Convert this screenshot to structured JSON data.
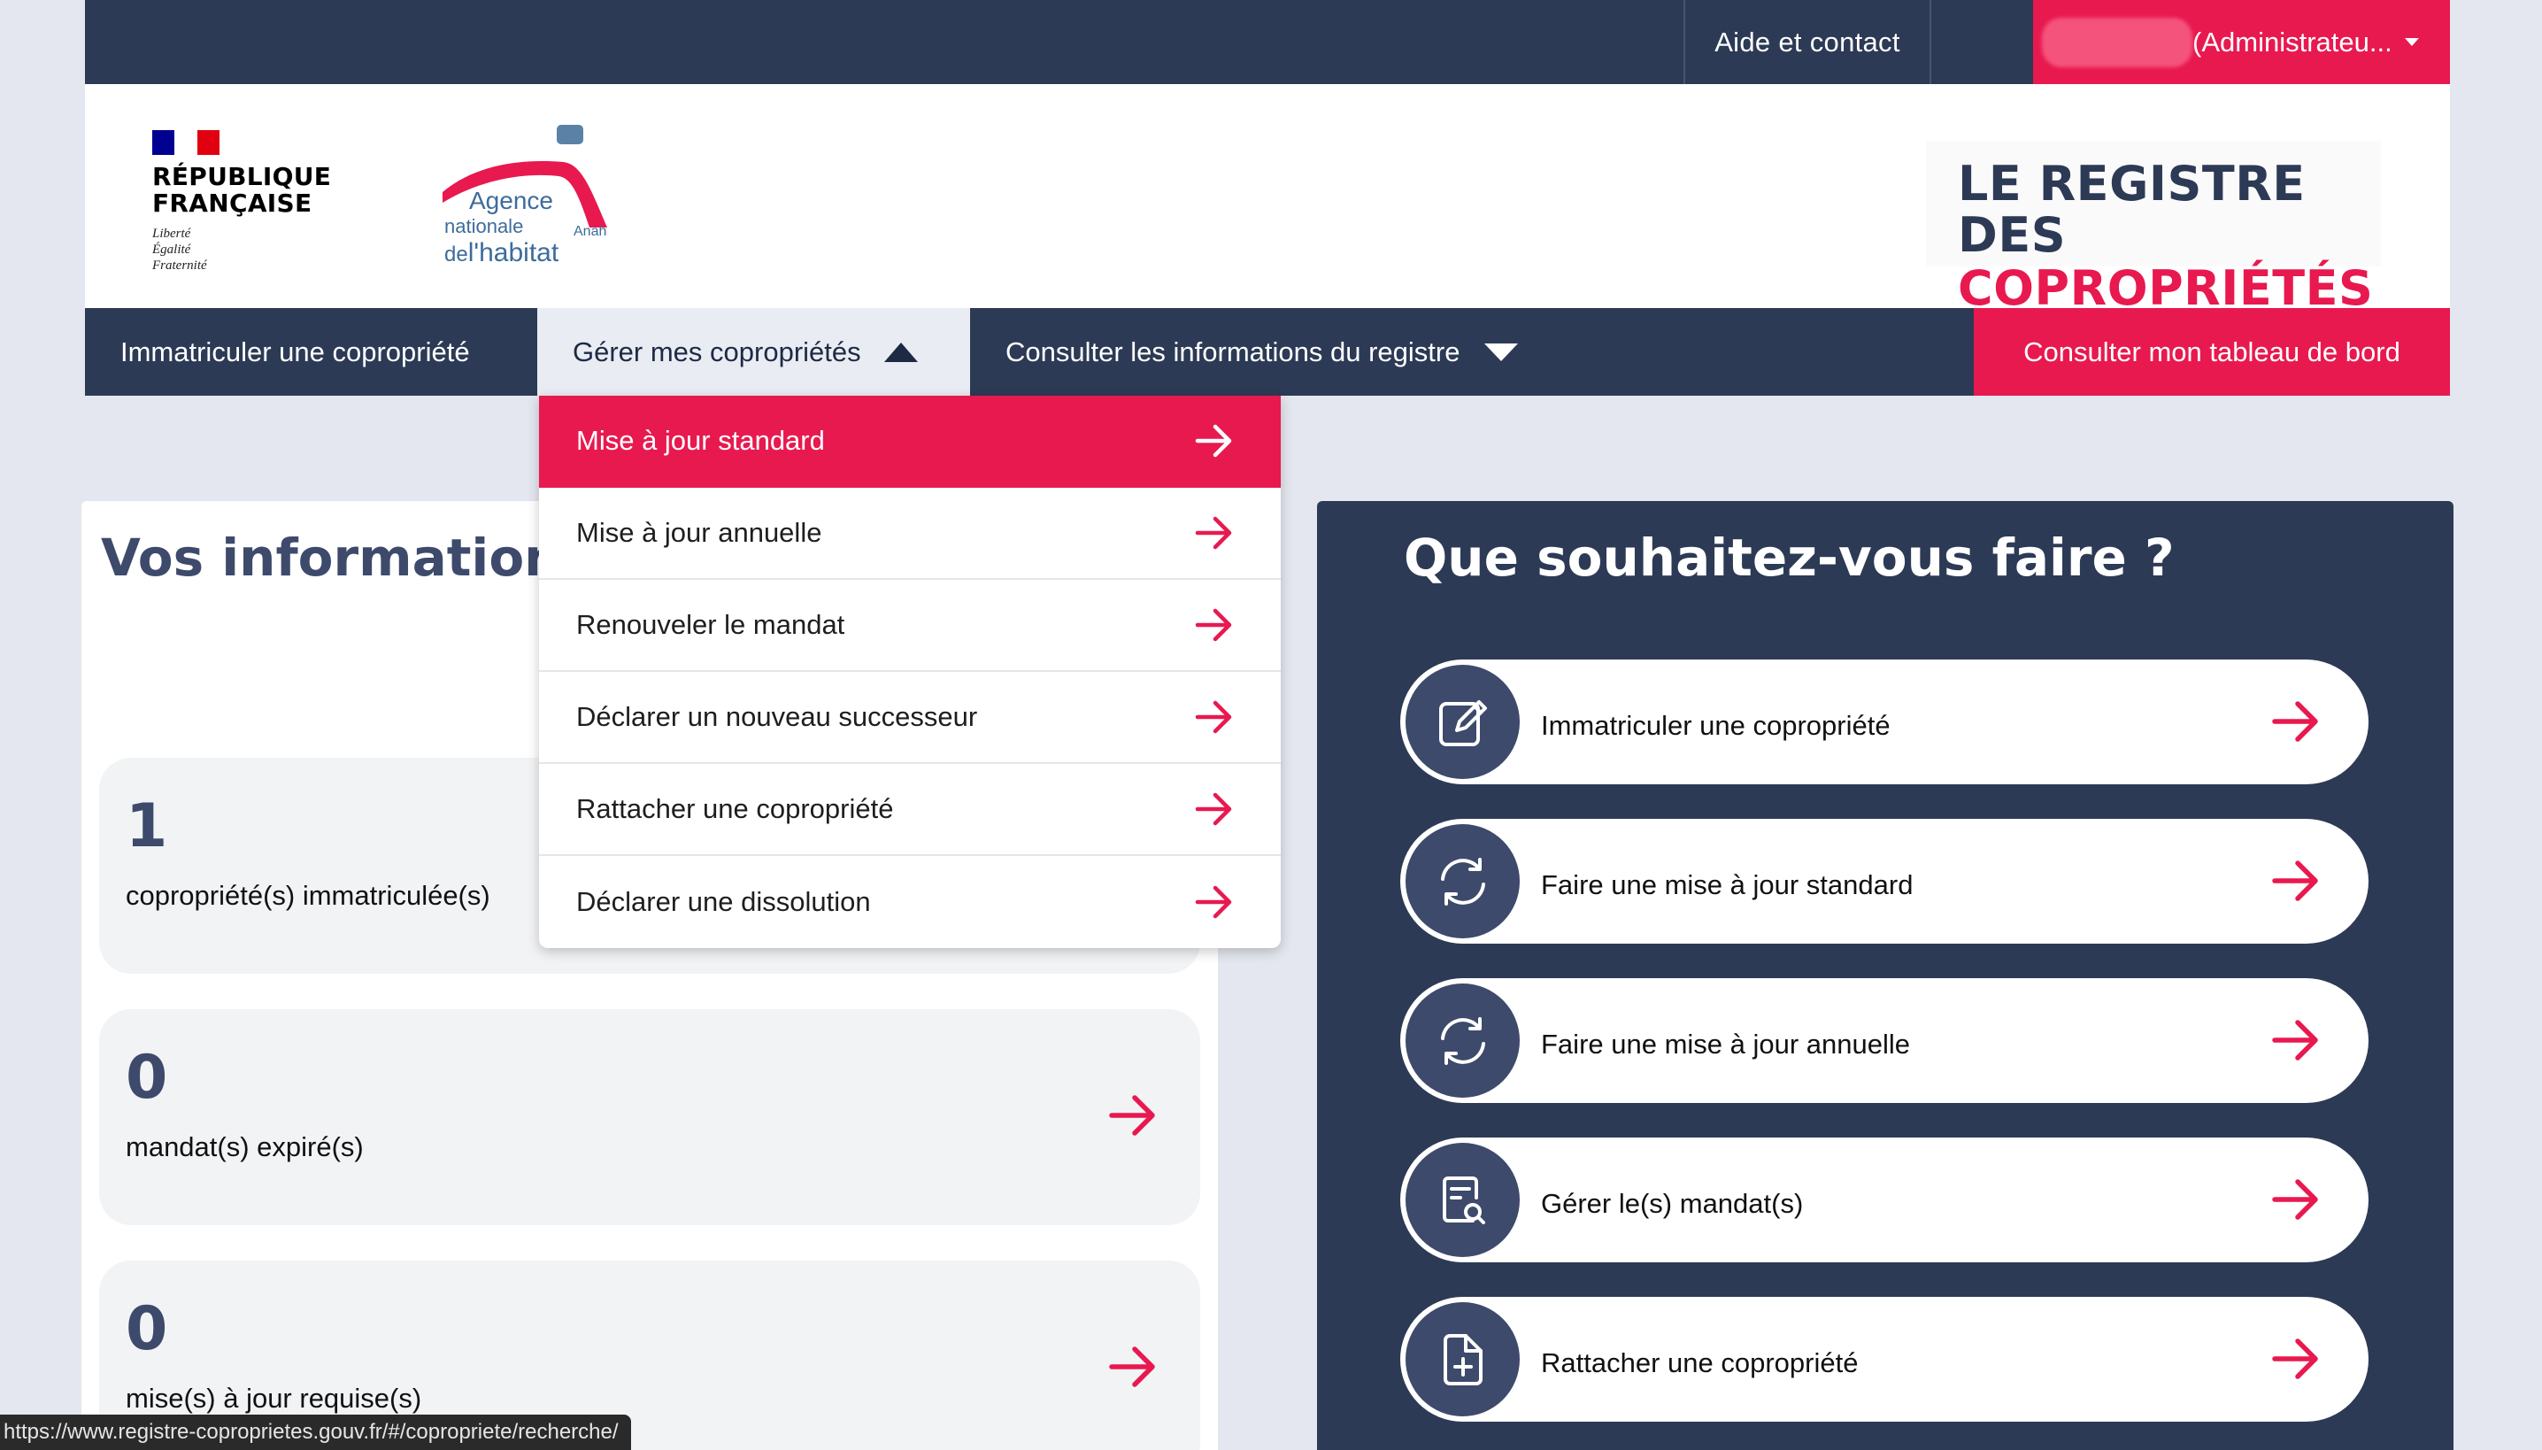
{
  "topbar": {
    "help_label": "Aide et contact",
    "bell_icon": "bell-icon",
    "user_role": "(Administrateu...",
    "user_caret_icon": "caret-down-icon"
  },
  "header": {
    "republique": [
      "RÉPUBLIQUE",
      "FRANÇAISE"
    ],
    "motto": [
      "Liberté",
      "Égalité",
      "Fraternité"
    ],
    "anah": {
      "line1": "Agence",
      "line2": "nationale",
      "line3_prefix": "de",
      "line3": "l'habitat",
      "tag": "Anah"
    },
    "registre_line1": "LE REGISTRE DES",
    "registre_line2": "COPROPRIÉTÉS",
    "colors": {
      "navy": "#2c3a55",
      "red": "#e8194f",
      "flag_blue": "#000091",
      "flag_red": "#e1000f"
    }
  },
  "nav": {
    "item1": "Immatriculer une copropriété",
    "item2": "Gérer mes copropriétés",
    "item3": "Consulter les informations du registre",
    "item4": "Consulter mon tableau de bord"
  },
  "dropdown": {
    "items": [
      {
        "label": "Mise à jour standard",
        "active": true
      },
      {
        "label": "Mise à jour annuelle",
        "active": false
      },
      {
        "label": "Renouveler le mandat",
        "active": false
      },
      {
        "label": "Déclarer un nouveau successeur",
        "active": false
      },
      {
        "label": "Rattacher une copropriété",
        "active": false
      },
      {
        "label": "Déclarer une dissolution",
        "active": false
      }
    ]
  },
  "info": {
    "title": "Vos informations",
    "stats": [
      {
        "value": "1",
        "label": "copropriété(s) immatriculée(s)"
      },
      {
        "value": "0",
        "label": "mandat(s) expiré(s)"
      },
      {
        "value": "0",
        "label": "mise(s) à jour requise(s)"
      }
    ]
  },
  "actions": {
    "title": "Que souhaitez-vous faire ?",
    "items": [
      {
        "label": "Immatriculer une copropriété",
        "icon": "edit-icon"
      },
      {
        "label": "Faire une mise à jour standard",
        "icon": "refresh-icon"
      },
      {
        "label": "Faire une mise à jour annuelle",
        "icon": "refresh-icon"
      },
      {
        "label": "Gérer le(s) mandat(s)",
        "icon": "document-search-icon"
      },
      {
        "label": "Rattacher une copropriété",
        "icon": "file-add-icon"
      }
    ]
  },
  "status_url": "https://www.registre-coproprietes.gouv.fr/#/copropriete/recherche/"
}
